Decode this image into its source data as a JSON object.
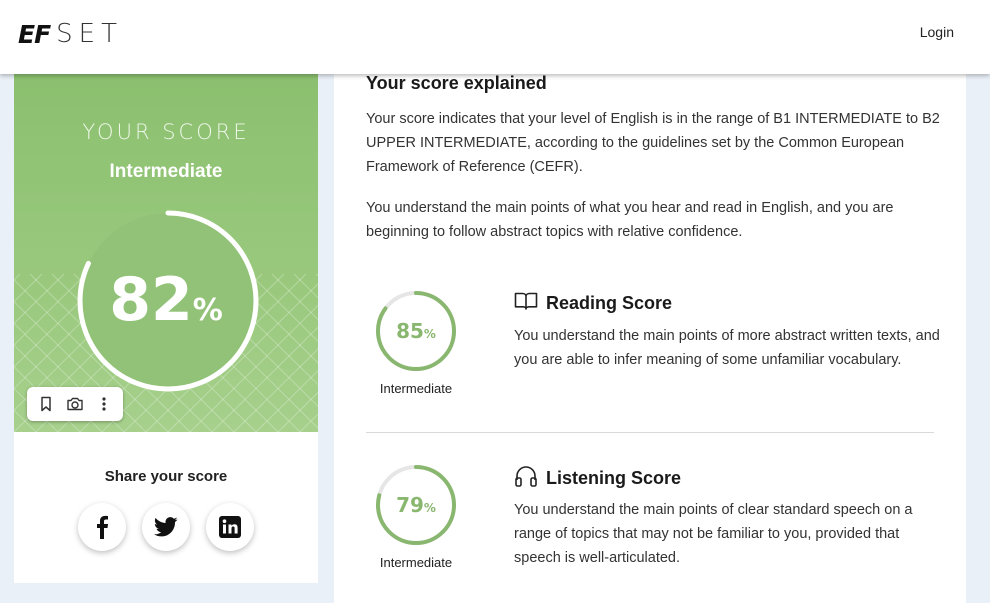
{
  "header": {
    "logo_mark": "EF",
    "logo_text": "SET",
    "login_label": "Login"
  },
  "score_card": {
    "title": "YOUR SCORE",
    "level": "Intermediate",
    "score": "82",
    "score_fraction": 0.82,
    "percent_sign": "%",
    "toolbar_icons": [
      "bookmark-icon",
      "camera-icon",
      "more-vertical-icon"
    ],
    "share_title": "Share your score",
    "social_icons": [
      "facebook-icon",
      "twitter-icon",
      "linkedin-icon"
    ]
  },
  "explanation": {
    "title": "Your score explained",
    "paragraph1": "Your score indicates that your level of English is in the range of B1 INTERMEDIATE to B2 UPPER INTERMEDIATE, according to the guidelines set by the Common European Framework of Reference (CEFR).",
    "paragraph2": "You understand the main points of what you hear and read in English, and you are beginning to follow abstract topics with relative confidence."
  },
  "reading": {
    "score": "85",
    "score_fraction": 0.85,
    "percent_sign": "%",
    "level": "Intermediate",
    "icon": "book-icon",
    "title": "Reading Score",
    "text": "You understand the main points of more abstract written texts, and you are able to infer meaning of some unfamiliar vocabulary."
  },
  "listening": {
    "score": "79",
    "score_fraction": 0.79,
    "percent_sign": "%",
    "level": "Intermediate",
    "icon": "headphones-icon",
    "title": "Listening Score",
    "text": "You understand the main points of clear standard speech on a range of topics that may not be familiar to you, provided that speech is well-articulated."
  },
  "colors": {
    "accent_green": "#8ab76f",
    "panel_green": "#9ac97e",
    "page_bg": "#e9f0f7"
  }
}
